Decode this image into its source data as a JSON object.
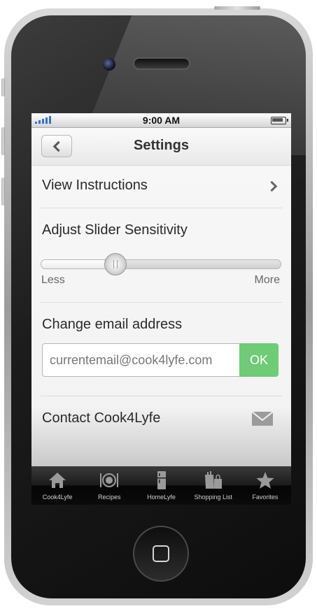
{
  "status_bar": {
    "time": "9:00 AM"
  },
  "nav": {
    "title": "Settings",
    "back_icon": "chevron-left-icon"
  },
  "settings": {
    "view_instructions": "View Instructions",
    "slider_title": "Adjust Slider Sensitivity",
    "slider_min_label": "Less",
    "slider_max_label": "More",
    "slider_value_fraction": 0.31,
    "email_title": "Change email address",
    "email_value": "currentemail@cook4lyfe.com",
    "ok_label": "OK",
    "contact_label": "Contact Cook4Lyfe"
  },
  "tabs": [
    {
      "label": "Cook4Lyfe",
      "icon": "home-icon"
    },
    {
      "label": "Recipes",
      "icon": "plate-cutlery-icon"
    },
    {
      "label": "HomeLyfe",
      "icon": "fridge-icon"
    },
    {
      "label": "Shopping List",
      "icon": "shopping-bag-icon"
    },
    {
      "label": "Favorites",
      "icon": "star-icon"
    }
  ],
  "colors": {
    "ok_green": "#6ecb76",
    "tab_bar": "#111111",
    "signal_blue": "#3b6fd0"
  }
}
